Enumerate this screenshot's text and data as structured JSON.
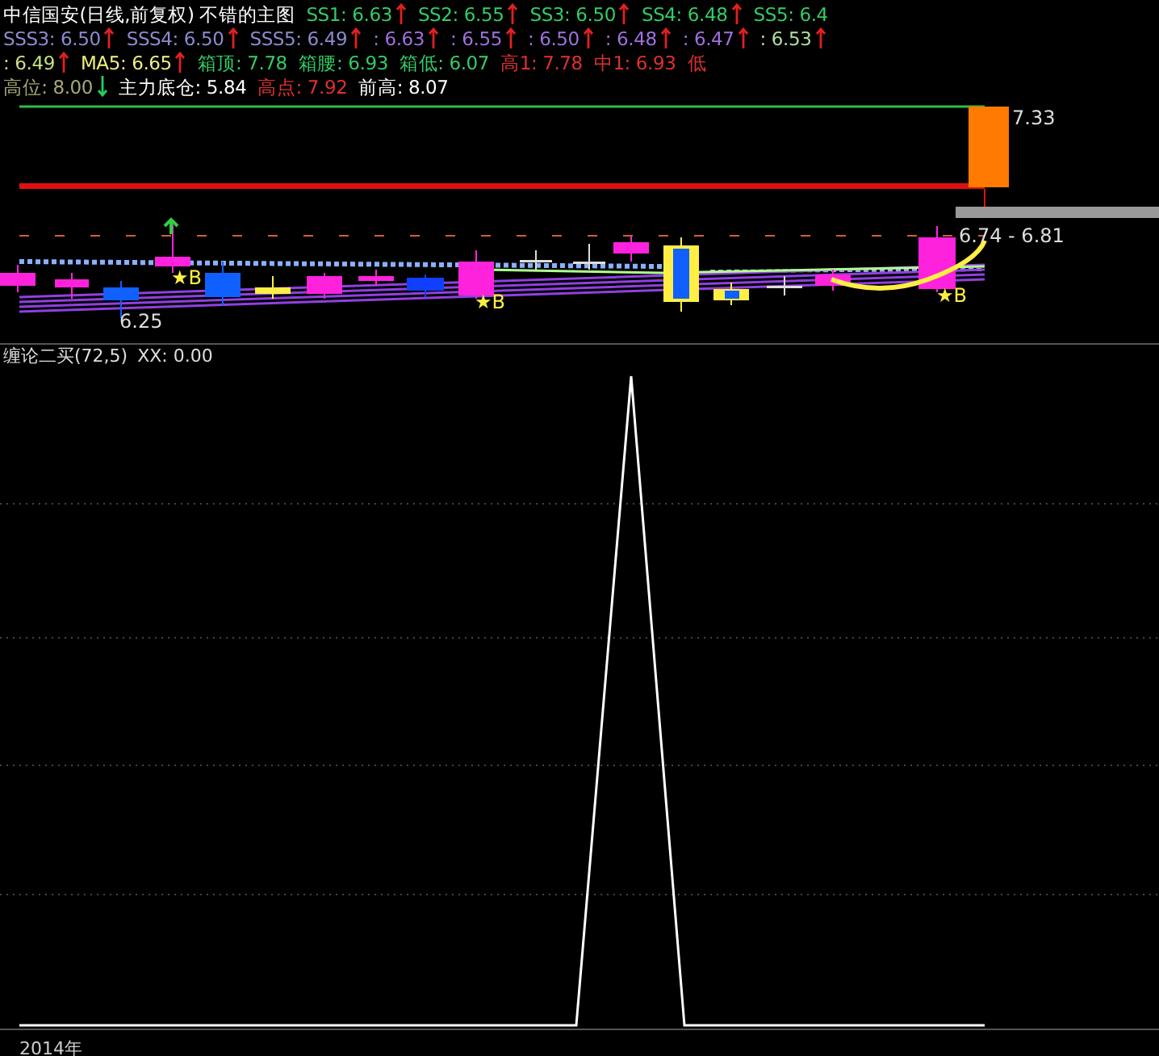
{
  "legend_rows": [
    {
      "items": [
        {
          "text": "中信国安(日线,前复权) 不错的主图",
          "color": "#ffffff"
        },
        {
          "text": "SS1: 6.63",
          "color": "#33cc66",
          "rising": true
        },
        {
          "text": "SS2: 6.55",
          "color": "#33cc66",
          "rising": true
        },
        {
          "text": "SS3: 6.50",
          "color": "#33cc66",
          "rising": true
        },
        {
          "text": "SS4: 6.48",
          "color": "#33cc66",
          "rising": true
        },
        {
          "text": "SS5: 6.4",
          "color": "#33cc66"
        }
      ]
    },
    {
      "items": [
        {
          "text": "SSS3: 6.50",
          "color": "#8c8cd0",
          "rising": true
        },
        {
          "text": "SSS4: 6.50",
          "color": "#8c8cd0",
          "rising": true
        },
        {
          "text": "SSS5: 6.49",
          "color": "#8c8cd0",
          "rising": true
        },
        {
          "text": ": 6.63",
          "color": "#a070e0",
          "rising": true
        },
        {
          "text": ": 6.55",
          "color": "#a070e0",
          "rising": true
        },
        {
          "text": ": 6.50",
          "color": "#a070e0",
          "rising": true
        },
        {
          "text": ": 6.48",
          "color": "#a070e0",
          "rising": true
        },
        {
          "text": ": 6.47",
          "color": "#a070e0",
          "rising": true
        },
        {
          "text": ": 6.53",
          "color": "#b0e0a0",
          "rising": true
        }
      ]
    },
    {
      "items": [
        {
          "text": ": 6.49",
          "color": "#c8e080",
          "rising": true
        },
        {
          "text": "MA5: 6.65",
          "color": "#f0f080",
          "rising": true
        },
        {
          "text": "箱顶: 7.78",
          "color": "#33cc66"
        },
        {
          "text": "箱腰: 6.93",
          "color": "#33cc66"
        },
        {
          "text": "箱低: 6.07",
          "color": "#33cc66"
        },
        {
          "text": "高1: 7.78",
          "color": "#e03030"
        },
        {
          "text": "中1: 6.93",
          "color": "#e03030"
        },
        {
          "text": "低",
          "color": "#e03030"
        }
      ]
    },
    {
      "items": [
        {
          "text": "高位: 8.00",
          "color": "#a8a878",
          "rising": false
        },
        {
          "text": "主力底仓: 5.84",
          "color": "#ffffff"
        },
        {
          "text": "高点: 7.92",
          "color": "#e03030"
        },
        {
          "text": "前高: 8.07",
          "color": "#ffffff"
        }
      ]
    }
  ],
  "price_labels": [
    "7.33",
    "6.74 - 6.81",
    "6.25"
  ],
  "buy_marks": [
    "★B",
    "★B",
    "★B"
  ],
  "indicator": {
    "title": "缠论二买(72,5)",
    "reading": "XX: 0.00"
  },
  "date_label": "2014年"
}
